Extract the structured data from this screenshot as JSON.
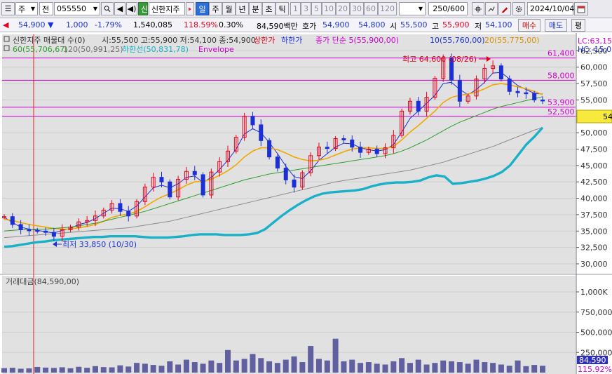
{
  "toolbar": {
    "menu_glyph": "☰",
    "market_type": "주",
    "period_type": "전",
    "code": "055550",
    "prev_glyph": "◀",
    "audio_glyph": "◀)",
    "credit_badge": "신",
    "name": "신한지주",
    "period_tabs": [
      "일",
      "주",
      "월",
      "년",
      "분",
      "초",
      "틱"
    ],
    "active_period_index": 0,
    "minute_steps": [
      "1",
      "3",
      "5",
      "10",
      "20",
      "30",
      "60",
      "120"
    ],
    "view_count": "250/600",
    "date": "2024/10/04"
  },
  "quote": {
    "price": "54,900",
    "change_arrow": "▼",
    "change": "1,000",
    "change_pct": "-1.79%",
    "volume": "1,540,085",
    "volume_ratio": "118.59%",
    "turnover": "0.30%",
    "amount": "84,590백만",
    "bid_label": "호가",
    "bid_price": "54,900",
    "ask_price": "54,800",
    "open_label": "시",
    "open": "55,500",
    "high_label": "고",
    "high": "55,900",
    "low_label": "저",
    "low": "54,100",
    "buy_button": "매수",
    "sell_button": "매도",
    "eval_button": "평"
  },
  "legend": {
    "title": "신한지주 매물대 수(0)",
    "ohlc": "시:55,500 고:55,900 저:54,100 종:54,900",
    "upper_limit": "상한가",
    "lower_limit": "하한가",
    "ma5": "종가 단순 5(55,900,00)",
    "ma10": "10(55,760,00)",
    "ma20": "20(55,775,00)",
    "ma60": "60(55,706,67)",
    "ma120": "120(50,991,25)",
    "lower_band": "하한선(50,831,78)",
    "envelope": "Envelope",
    "lc_label": "LC:63,15",
    "hc_label": "HC:-15,02"
  },
  "annotations": {
    "high": "최고 64,600 (08/26)",
    "low": "최저 33,850 (10/30)"
  },
  "price_lines": [
    {
      "label": "61,400",
      "value": 61400
    },
    {
      "label": "58,000",
      "value": 58000
    },
    {
      "label": "53,900",
      "value": 53900
    },
    {
      "label": "52,500",
      "value": 52500
    }
  ],
  "current_price_tag": "54",
  "volume_panel": {
    "title": "거래대금(84,590,00)",
    "current_tag": "84,590",
    "ratio_tag": "115.92%"
  },
  "colors": {
    "up": "#e8001c",
    "down": "#1c2fd6",
    "ma5": "#1c2fd6",
    "ma20": "#f0a800",
    "ma60": "#2e9e2e",
    "ma120": "#8c8c8c",
    "lower_band": "#1ab0c8",
    "envelope": "#d000d0",
    "volume": "#6060a0"
  },
  "chart_data": [
    {
      "type": "line",
      "title": "신한지주 매물대 수(0)",
      "y_axis_ticks": [
        62500,
        60000,
        57500,
        55000,
        52500,
        50000,
        47500,
        45000,
        42500,
        40000,
        37500,
        35000,
        32500,
        30000
      ],
      "y_axis_labels": [
        "62,500",
        "60,000",
        "57,500",
        "55,000",
        "52,500",
        "50,000",
        "47,500",
        "45,000",
        "42,500",
        "40,000",
        "37,500",
        "35,000",
        "32,500",
        "30,000"
      ],
      "ylim": [
        28500,
        65000
      ],
      "series": [
        {
          "name": "종가",
          "values": [
            37200,
            36000,
            35200,
            35100,
            35000,
            34800,
            34200,
            35200,
            35600,
            36400,
            36600,
            37300,
            38200,
            39200,
            38000,
            37300,
            39500,
            41700,
            43200,
            42500,
            40200,
            42900,
            44100,
            43600,
            40500,
            44000,
            45600,
            47200,
            49300,
            52500,
            51200,
            48800,
            46300,
            44600,
            42800,
            41700,
            43900,
            46500,
            47800,
            47600,
            49100,
            48900,
            47800,
            47000,
            47500,
            46800,
            47700,
            49600,
            53300,
            54800,
            53300,
            55400,
            58300,
            61400,
            58000,
            54800,
            55600,
            58200,
            59800,
            60200,
            58200,
            56300,
            56100,
            56000,
            55000,
            54900
          ]
        },
        {
          "name": "5",
          "values": [
            37100,
            36300,
            35600,
            35300,
            35100,
            34900,
            34700,
            35100,
            35400,
            36000,
            36300,
            36900,
            37700,
            38500,
            38400,
            38000,
            38800,
            40200,
            41600,
            42000,
            41600,
            42200,
            43200,
            43400,
            42400,
            43200,
            44400,
            45800,
            47500,
            49800,
            50600,
            50000,
            48500,
            46800,
            44900,
            43300,
            43000,
            44200,
            45800,
            46800,
            47800,
            48400,
            48300,
            47700,
            47400,
            47200,
            47400,
            48200,
            50100,
            52200,
            53300,
            54500,
            55700,
            57500,
            57700,
            56600,
            55800,
            56600,
            57700,
            59100,
            59200,
            58200,
            57200,
            56600,
            56000,
            55900
          ]
        },
        {
          "name": "20",
          "values": [
            36800,
            36600,
            36300,
            36000,
            35800,
            35600,
            35400,
            35300,
            35300,
            35500,
            35700,
            36000,
            36500,
            37100,
            37400,
            37600,
            38000,
            38700,
            39500,
            40200,
            40700,
            41300,
            42000,
            42500,
            42600,
            42900,
            43500,
            44200,
            45100,
            46300,
            47200,
            47700,
            47700,
            47400,
            46900,
            46300,
            45900,
            45700,
            45800,
            46100,
            46600,
            47100,
            47500,
            47700,
            47700,
            47600,
            47600,
            47900,
            48900,
            50100,
            51100,
            52200,
            53300,
            54600,
            55400,
            55700,
            55900,
            56200,
            56700,
            57300,
            57500,
            57300,
            57000,
            56700,
            56300,
            55800
          ]
        },
        {
          "name": "60",
          "values": [
            35000,
            35100,
            35200,
            35200,
            35300,
            35300,
            35400,
            35500,
            35600,
            35800,
            36000,
            36200,
            36500,
            36800,
            37100,
            37400,
            37700,
            38000,
            38400,
            38800,
            39200,
            39600,
            40000,
            40400,
            40800,
            41200,
            41600,
            42000,
            42400,
            42800,
            43100,
            43400,
            43700,
            43900,
            44100,
            44300,
            44500,
            44700,
            44900,
            45100,
            45300,
            45500,
            45700,
            45900,
            46100,
            46300,
            46500,
            46800,
            47200,
            47700,
            48300,
            48900,
            49600,
            50300,
            51000,
            51600,
            52100,
            52600,
            53100,
            53600,
            54000,
            54300,
            54600,
            54900,
            55200,
            55500
          ]
        },
        {
          "name": "120",
          "values": [
            34000,
            34100,
            34200,
            34300,
            34400,
            34500,
            34600,
            34700,
            34800,
            34900,
            35000,
            35100,
            35200,
            35300,
            35400,
            35500,
            35700,
            35900,
            36100,
            36300,
            36500,
            36800,
            37100,
            37400,
            37700,
            38000,
            38300,
            38600,
            38900,
            39200,
            39500,
            39800,
            40100,
            40400,
            40700,
            41000,
            41300,
            41600,
            41900,
            42200,
            42500,
            42700,
            42900,
            43100,
            43300,
            43500,
            43700,
            43900,
            44100,
            44300,
            44600,
            44900,
            45200,
            45500,
            45900,
            46300,
            46700,
            47100,
            47500,
            47900,
            48400,
            48900,
            49400,
            49900,
            50400,
            50800
          ]
        },
        {
          "name": "하한선",
          "values": [
            32600,
            32700,
            32900,
            33100,
            33300,
            33400,
            33600,
            33700,
            33800,
            33900,
            34000,
            34100,
            34100,
            34200,
            34200,
            34200,
            34200,
            34100,
            34000,
            34000,
            34000,
            34100,
            34200,
            34400,
            34500,
            34500,
            34500,
            34400,
            34400,
            34400,
            34500,
            34700,
            35300,
            36300,
            37300,
            38200,
            39000,
            39700,
            40300,
            40700,
            40900,
            41000,
            41100,
            41200,
            41400,
            41800,
            42100,
            42300,
            42400,
            42400,
            42500,
            42700,
            43200,
            43500,
            43300,
            42200,
            42300,
            42500,
            42700,
            43000,
            43400,
            44000,
            45000,
            46600,
            48200,
            49400,
            50800
          ]
        }
      ]
    },
    {
      "type": "bar",
      "title": "거래대금(84,590,00)",
      "y_axis_ticks": [
        1000000,
        750000,
        500000,
        250000
      ],
      "y_axis_labels": [
        "1,000K",
        "750,000",
        "500,000",
        "250,000"
      ],
      "ylim": [
        0,
        1200000
      ],
      "values": [
        55000,
        60000,
        48000,
        52000,
        70000,
        62000,
        58000,
        66000,
        54000,
        72000,
        60000,
        80000,
        68000,
        65000,
        90000,
        75000,
        120000,
        110000,
        95000,
        85000,
        140000,
        100000,
        160000,
        130000,
        110000,
        150000,
        120000,
        280000,
        150000,
        170000,
        230000,
        180000,
        140000,
        120000,
        160000,
        200000,
        130000,
        330000,
        170000,
        150000,
        420000,
        140000,
        160000,
        120000,
        130000,
        110000,
        100000,
        140000,
        180000,
        120000,
        160000,
        100000,
        120000,
        150000,
        140000,
        130000,
        110000,
        160000,
        130000,
        120000,
        100000,
        85000,
        150000,
        80000,
        95000,
        84590
      ]
    }
  ]
}
